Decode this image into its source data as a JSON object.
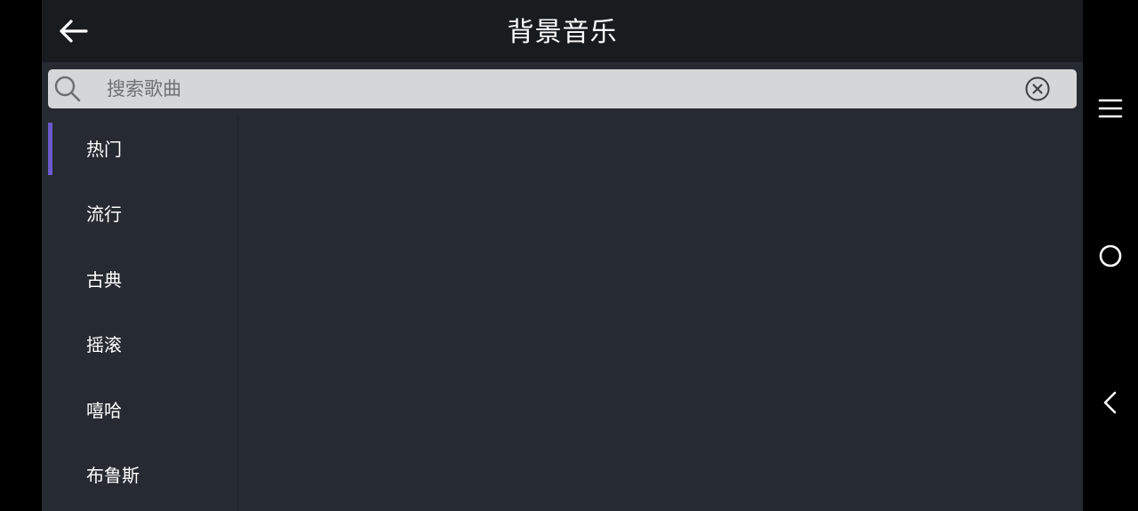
{
  "header": {
    "title": "背景音乐",
    "back_icon": "arrow-left-icon"
  },
  "search": {
    "placeholder": "搜索歌曲",
    "value": "",
    "search_icon": "search-icon",
    "clear_icon": "close-circle-icon"
  },
  "categories": [
    {
      "label": "热门",
      "active": true
    },
    {
      "label": "流行",
      "active": false
    },
    {
      "label": "古典",
      "active": false
    },
    {
      "label": "摇滚",
      "active": false
    },
    {
      "label": "嘻哈",
      "active": false
    },
    {
      "label": "布鲁斯",
      "active": false
    }
  ],
  "system_nav": {
    "menu_icon": "menu-icon",
    "home_icon": "home-circle-icon",
    "back_icon": "back-chevron-icon"
  },
  "colors": {
    "app_background": "#262a31",
    "header_background": "#191c1f",
    "search_background": "#d5d6d8",
    "active_indicator": "#6a5acd",
    "text": "#ffffff"
  }
}
